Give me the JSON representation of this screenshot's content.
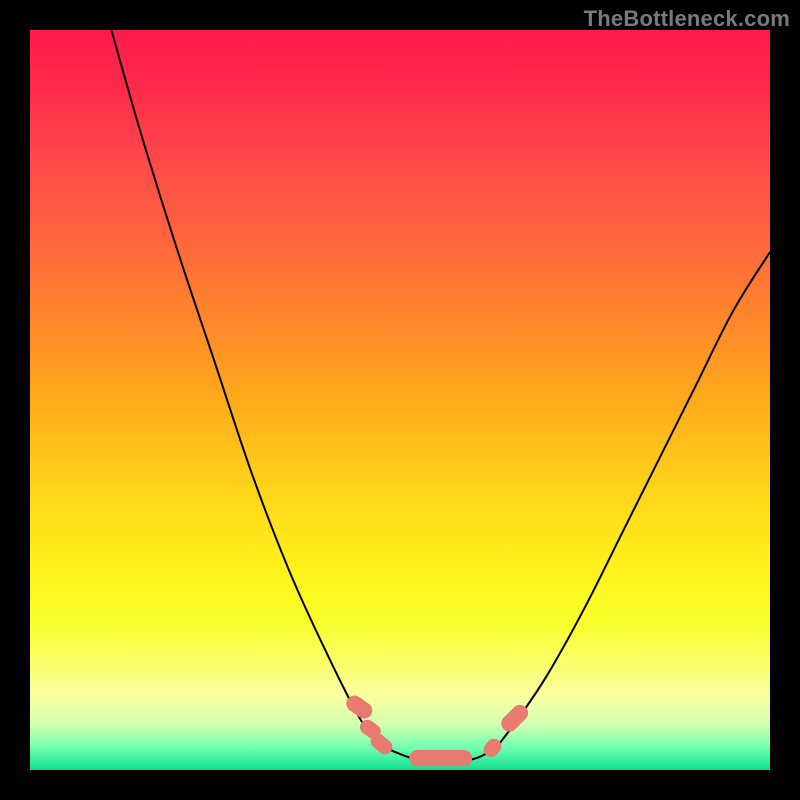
{
  "watermark": "TheBottleneck.com",
  "chart_data": {
    "type": "line",
    "title": "",
    "xlabel": "",
    "ylabel": "",
    "xlim": [
      0,
      100
    ],
    "ylim": [
      0,
      100
    ],
    "grid": false,
    "legend": false,
    "series": [
      {
        "name": "left-branch",
        "x": [
          11,
          15,
          20,
          25,
          30,
          35,
          40,
          44,
          46,
          48
        ],
        "y": [
          100,
          86,
          70,
          55,
          40,
          27,
          16,
          8,
          5,
          3
        ]
      },
      {
        "name": "floor",
        "x": [
          48,
          52,
          56,
          60,
          63
        ],
        "y": [
          3,
          1.5,
          1.2,
          1.5,
          3
        ]
      },
      {
        "name": "right-branch",
        "x": [
          63,
          66,
          70,
          75,
          80,
          85,
          90,
          95,
          100
        ],
        "y": [
          3,
          7,
          13,
          22,
          32,
          42,
          52,
          62,
          70
        ]
      }
    ],
    "markers": {
      "color": "#e87a6f",
      "points": [
        {
          "x": 44.5,
          "y": 8.5,
          "w": 2.2,
          "h": 3.8,
          "rot": -55
        },
        {
          "x": 46.0,
          "y": 5.5,
          "w": 2.0,
          "h": 3.0,
          "rot": -55
        },
        {
          "x": 47.5,
          "y": 3.5,
          "w": 2.0,
          "h": 3.2,
          "rot": -50
        },
        {
          "x": 55.5,
          "y": 1.6,
          "w": 8.5,
          "h": 2.2,
          "rot": 0
        },
        {
          "x": 62.5,
          "y": 3.0,
          "w": 2.0,
          "h": 2.6,
          "rot": 40
        },
        {
          "x": 65.5,
          "y": 7.0,
          "w": 2.2,
          "h": 4.2,
          "rot": 45
        }
      ]
    },
    "background_gradient": {
      "top": "#ff1a4d",
      "mid": "#ffd41a",
      "bottom": "#10e090"
    }
  }
}
